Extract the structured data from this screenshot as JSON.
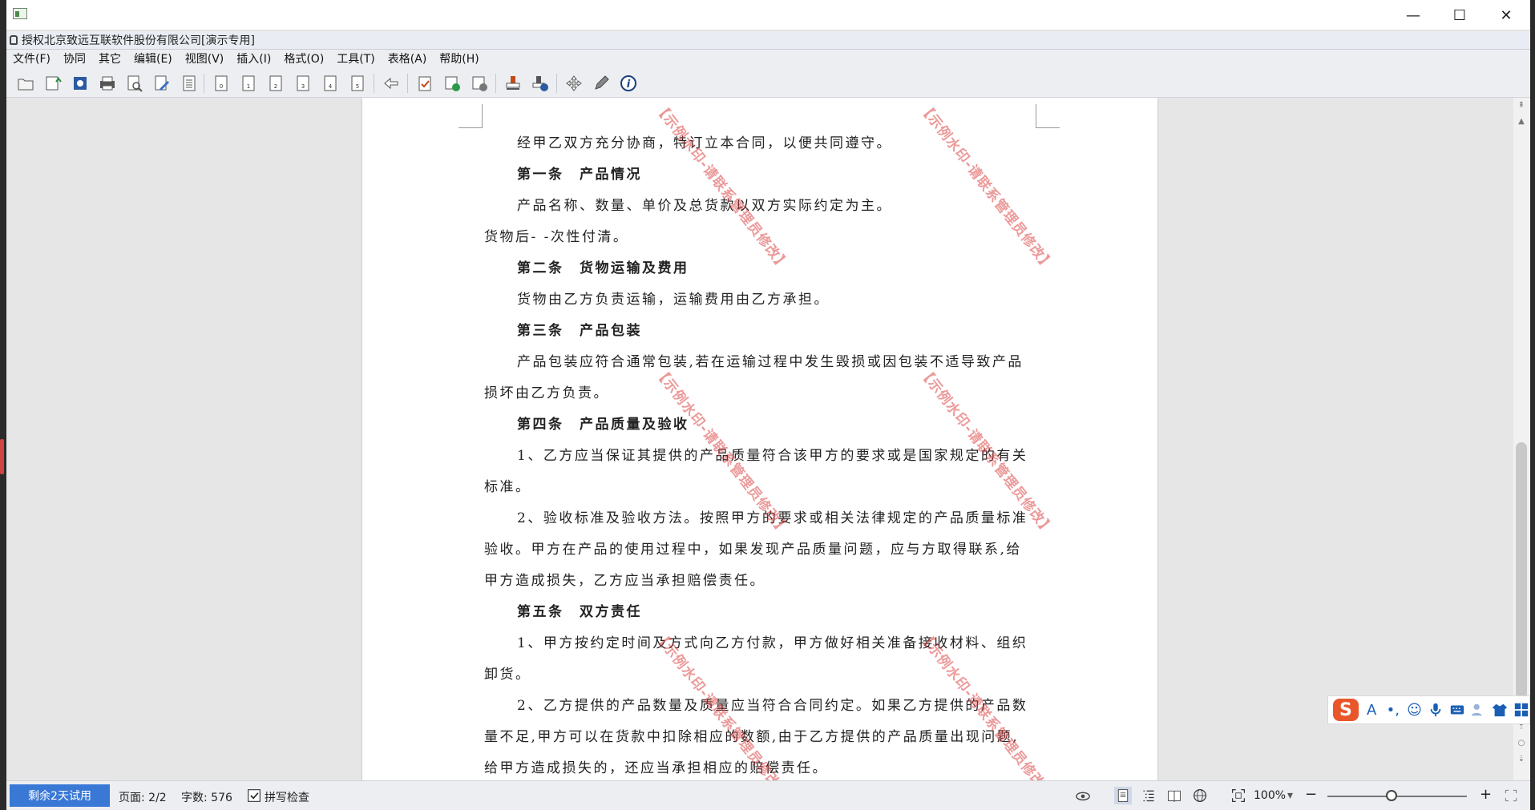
{
  "banner": {
    "text": "授权北京致远互联软件股份有限公司[演示专用]"
  },
  "window_controls": {
    "minimize": "—",
    "maximize": "☐",
    "close": "✕"
  },
  "menu": [
    "文件(F)",
    "协同",
    "其它",
    "编辑(E)",
    "视图(V)",
    "插入(I)",
    "格式(O)",
    "工具(T)",
    "表格(A)",
    "帮助(H)"
  ],
  "toolbar_icons": [
    "open-folder-icon",
    "save-upload-icon",
    "settings-icon",
    "print-icon",
    "print-preview-icon",
    "edit-doc-icon",
    "page-icon",
    "page-0-icon",
    "page-1-icon",
    "page-2-icon",
    "page-3-icon",
    "page-4-icon",
    "page-5-icon",
    "back-arrow-icon",
    "check-doc-icon",
    "approve-doc-icon",
    "reject-doc-icon",
    "stamp-icon",
    "signature-icon",
    "move-icon",
    "pen-icon",
    "info-icon"
  ],
  "document": {
    "lines": [
      {
        "text": "经甲乙双方充分协商，特订立本合同，以便共同遵守。",
        "style": "indent"
      },
      {
        "text": "第一条　产品情况",
        "style": "heading"
      },
      {
        "text": "产品名称、数量、单价及总货款以双方实际约定为主。",
        "style": "indent"
      },
      {
        "text": "货物后- -次性付清。",
        "style": "plain"
      },
      {
        "text": "第二条　货物运输及费用",
        "style": "heading"
      },
      {
        "text": "货物由乙方负责运输，运输费用由乙方承担。",
        "style": "indent"
      },
      {
        "text": "第三条　产品包装",
        "style": "heading"
      },
      {
        "text": "产品包装应符合通常包装,若在运输过程中发生毁损或因包装不适导致产品",
        "style": "indent"
      },
      {
        "text": "损坏由乙方负责。",
        "style": "plain"
      },
      {
        "text": "第四条　产品质量及验收",
        "style": "heading"
      },
      {
        "text": "1、乙方应当保证其提供的产品质量符合该甲方的要求或是国家规定的有关",
        "style": "indent"
      },
      {
        "text": "标准。",
        "style": "plain"
      },
      {
        "text": "2、验收标准及验收方法。按照甲方的要求或相关法律规定的产品质量标准",
        "style": "indent"
      },
      {
        "text": "验收。甲方在产品的使用过程中，如果发现产品质量问题，应与方取得联系,给",
        "style": "plain"
      },
      {
        "text": "甲方造成损失，乙方应当承担赔偿责任。",
        "style": "plain"
      },
      {
        "text": "第五条　双方责任",
        "style": "heading"
      },
      {
        "text": "1、甲方按约定时间及方式向乙方付款，甲方做好相关准备接收材料、组织",
        "style": "indent"
      },
      {
        "text": "卸货。",
        "style": "plain"
      },
      {
        "text": "2、乙方提供的产品数量及质量应当符合合同约定。如果乙方提供的产品数",
        "style": "indent"
      },
      {
        "text": "量不足,甲方可以在货款中扣除相应的数额,由于乙方提供的产品质量出现问题,",
        "style": "plain"
      },
      {
        "text": "给甲方造成损失的，还应当承担相应的赔偿责任。",
        "style": "plain"
      }
    ],
    "watermark": "【示例水印-请联系管理员修改】"
  },
  "statusbar": {
    "trial": "剩余2天试用",
    "page": "页面: 2/2",
    "words": "字数: 576",
    "spellcheck": "拼写检查",
    "zoom": "100%",
    "zoom_fraction": 0.46
  },
  "ime": {
    "logo": "S",
    "icons": [
      "A",
      "•,",
      "☺",
      "mic-icon",
      "keyboard-icon",
      "user-icon",
      "shirt-icon",
      "apps-icon"
    ]
  },
  "colors": {
    "trial_bg": "#3a78d6",
    "watermark": "#dc4646",
    "ime_logo": "#e8562a"
  }
}
